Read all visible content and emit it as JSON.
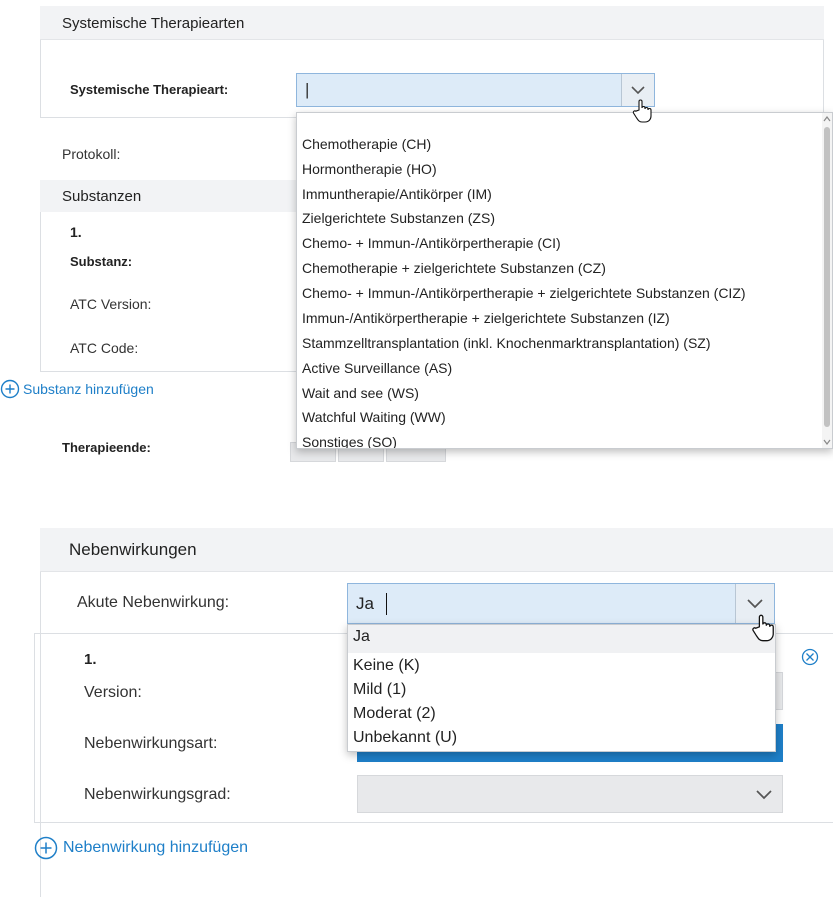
{
  "therapy": {
    "section_title": "Systemische Therapiearten",
    "therapy_type_label": "Systemische Therapieart:",
    "therapy_type_value": "|",
    "protocol_label": "Protokoll:",
    "substances_title": "Substanzen",
    "item_number": "1.",
    "substance_label": "Substanz:",
    "atc_version_label": "ATC Version:",
    "atc_code_label": "ATC Code:",
    "add_substance_label": "Substanz hinzufügen",
    "therapy_end_label": "Therapieende:",
    "options": [
      "Chemotherapie (CH)",
      "Hormontherapie (HO)",
      "Immuntherapie/Antikörper (IM)",
      "Zielgerichtete Substanzen (ZS)",
      "Chemo- + Immun-/Antikörpertherapie (CI)",
      "Chemotherapie + zielgerichtete Substanzen (CZ)",
      "Chemo- + Immun-/Antikörpertherapie + zielgerichtete Substanzen (CIZ)",
      "Immun-/Antikörpertherapie + zielgerichtete Substanzen (IZ)",
      "Stammzelltransplantation (inkl. Knochenmarktransplantation) (SZ)",
      "Active Surveillance (AS)",
      "Wait and see (WS)",
      "Watchful Waiting (WW)",
      "Sonstiges (SO)"
    ]
  },
  "side_effects": {
    "section_title": "Nebenwirkungen",
    "acute_label": "Akute Nebenwirkung:",
    "acute_value": "Ja",
    "item_number": "1.",
    "version_label": "Version:",
    "type_label": "Nebenwirkungsart:",
    "grade_label": "Nebenwirkungsgrad:",
    "add_label": "Nebenwirkung hinzufügen",
    "options": [
      "Ja",
      "Keine (K)",
      "Mild (1)",
      "Moderat (2)",
      "Unbekannt (U)"
    ]
  },
  "colors": {
    "link": "#1e7fc8",
    "combo_bg": "#ddebf8",
    "header_bg": "#f2f3f5",
    "selected_option_bg": "#f0f1f3"
  }
}
